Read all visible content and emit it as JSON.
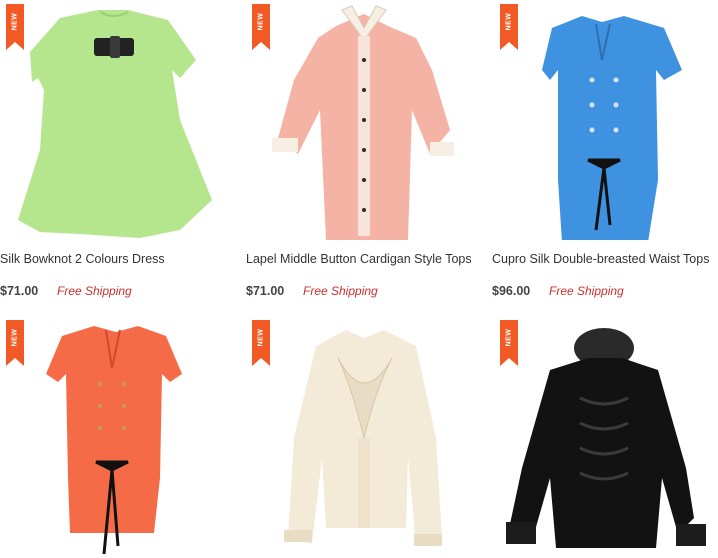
{
  "badge_text": "NEW",
  "colors": {
    "badge": "#f15a24",
    "price": "#444444",
    "shipping": "#c9302c"
  },
  "products": [
    {
      "title": "Silk Bowknot 2 Colours Dress",
      "price": "$71.00",
      "shipping": "Free Shipping",
      "garment_color": "#b5e58c"
    },
    {
      "title": "Lapel Middle Button Cardigan Style Tops",
      "price": "$71.00",
      "shipping": "Free Shipping",
      "garment_color": "#f4b3a4"
    },
    {
      "title": "Cupro Silk Double-breasted Waist Tops",
      "price": "$96.00",
      "shipping": "Free Shipping",
      "garment_color": "#3f92e0"
    },
    {
      "title": "",
      "price": "",
      "shipping": "",
      "garment_color": "#f66b47"
    },
    {
      "title": "",
      "price": "",
      "shipping": "",
      "garment_color": "#f4ead8"
    },
    {
      "title": "",
      "price": "",
      "shipping": "",
      "garment_color": "#111111"
    }
  ]
}
